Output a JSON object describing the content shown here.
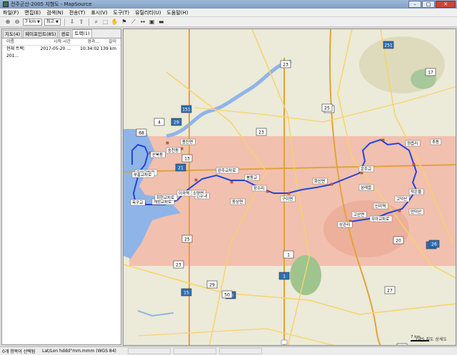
{
  "window": {
    "title": "전주군산-2005 지형도 - MapSource",
    "min": "–",
    "max": "□",
    "close": "✕"
  },
  "menu": [
    "파일(F)",
    "편집(E)",
    "검색(N)",
    "전송(T)",
    "표시(V)",
    "도구(T)",
    "유틸리티(U)",
    "도움말(H)"
  ],
  "toolbar": {
    "zoom_scale": "7 km",
    "detail": "최고"
  },
  "left_panel": {
    "tabs": [
      "지도(4)",
      "웨이포인트(85)",
      "경로",
      "트랙(1)"
    ],
    "columns": [
      "이름",
      "시작 시간",
      "경과...",
      "길이"
    ],
    "rows": [
      {
        "name": "현재 트랙: 201...",
        "date": "2017-05-20 ...",
        "time": "10:34:02",
        "length": "139 km"
      }
    ]
  },
  "map": {
    "shields": [
      "251",
      "23",
      "17",
      "151",
      "25",
      "4",
      "29",
      "68",
      "23",
      "21",
      "13",
      "1",
      "26",
      "20",
      "25",
      "30",
      "29",
      "50",
      "15",
      "27",
      "23",
      "1",
      "19",
      "25",
      "26"
    ],
    "labels": [
      "산북동",
      "군산교차로",
      "부흥교차로",
      "옥구교",
      "개정교차로",
      "회현교차로",
      "이곡역",
      "전주역",
      "송천동",
      "용진면",
      "소양면",
      "동상면",
      "구이면",
      "완주교차로",
      "봉동교",
      "장수리",
      "운주교",
      "화산면",
      "고산면",
      "상관리",
      "신리역",
      "우아교차로",
      "삼례읍",
      "정읍리",
      "추동",
      "작은물",
      "고덕산",
      "만덕산"
    ],
    "scale_label": "7 km",
    "copyright": "GPS 지도 상세도"
  },
  "status": {
    "selection": "0개 항목이 선택됨",
    "coord_format": "Lat/Lon hddd°mm.mmm (WGS 84)"
  },
  "colors": {
    "track": "#2244dd",
    "dem_tint": "#f3b9a8",
    "water": "#8fb4e8",
    "highway": "#e0a33c",
    "road": "#f6d36a"
  }
}
